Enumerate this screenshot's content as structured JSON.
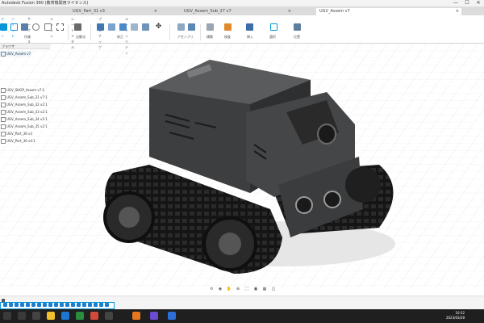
{
  "window": {
    "title": "Autodesk Fusion 360 (教育機関用ライセンス)",
    "controls": [
      "—",
      "☐",
      "✕"
    ]
  },
  "tabs": [
    {
      "label": "UGV_Part_31 v3",
      "active": false
    },
    {
      "label": "UGV_Assem_Sub_27 v7",
      "active": false
    },
    {
      "label": "UGV_Assem v7",
      "active": true
    }
  ],
  "toolbar": {
    "workspace": "デザイン",
    "workspace_tabs": [
      "ソリッド",
      "サーフェス",
      "メッシュ",
      "シートメタル",
      "プラスチック",
      "ユーティリティ"
    ],
    "groups": [
      "作成",
      "自動化",
      "修正",
      "アセンブリ",
      "構築",
      "検査",
      "挿入",
      "選択",
      "位置"
    ]
  },
  "browser": {
    "header": "ブラウザ",
    "items": [
      "UGV_Assem v7",
      "UGV_SHOP_Assem v7:1",
      "UGV_Assem_Sub_31 v7:1",
      "UGV_Assem_Sub_32 v2:1",
      "UGV_Assem_Sub_33 v2:1",
      "UGV_Assem_Sub_34 v2:1",
      "UGV_Assem_Sub_35 v2:1",
      "UGV_Part_36 v3",
      "UGV_Part_36 v4:1"
    ]
  },
  "navbar": {
    "icons": [
      "orbit-icon",
      "look-at-icon",
      "pan-icon",
      "zoom-icon",
      "fit-icon",
      "display-icon",
      "grid-icon",
      "viewports-icon"
    ]
  },
  "timeline": {
    "feature_count": 20
  },
  "taskbar": {
    "time": "10:32",
    "date": "2023/03/28"
  },
  "colors": {
    "accent": "#0696d7",
    "body": "#3d3e3f",
    "track": "#1b1b1b"
  }
}
